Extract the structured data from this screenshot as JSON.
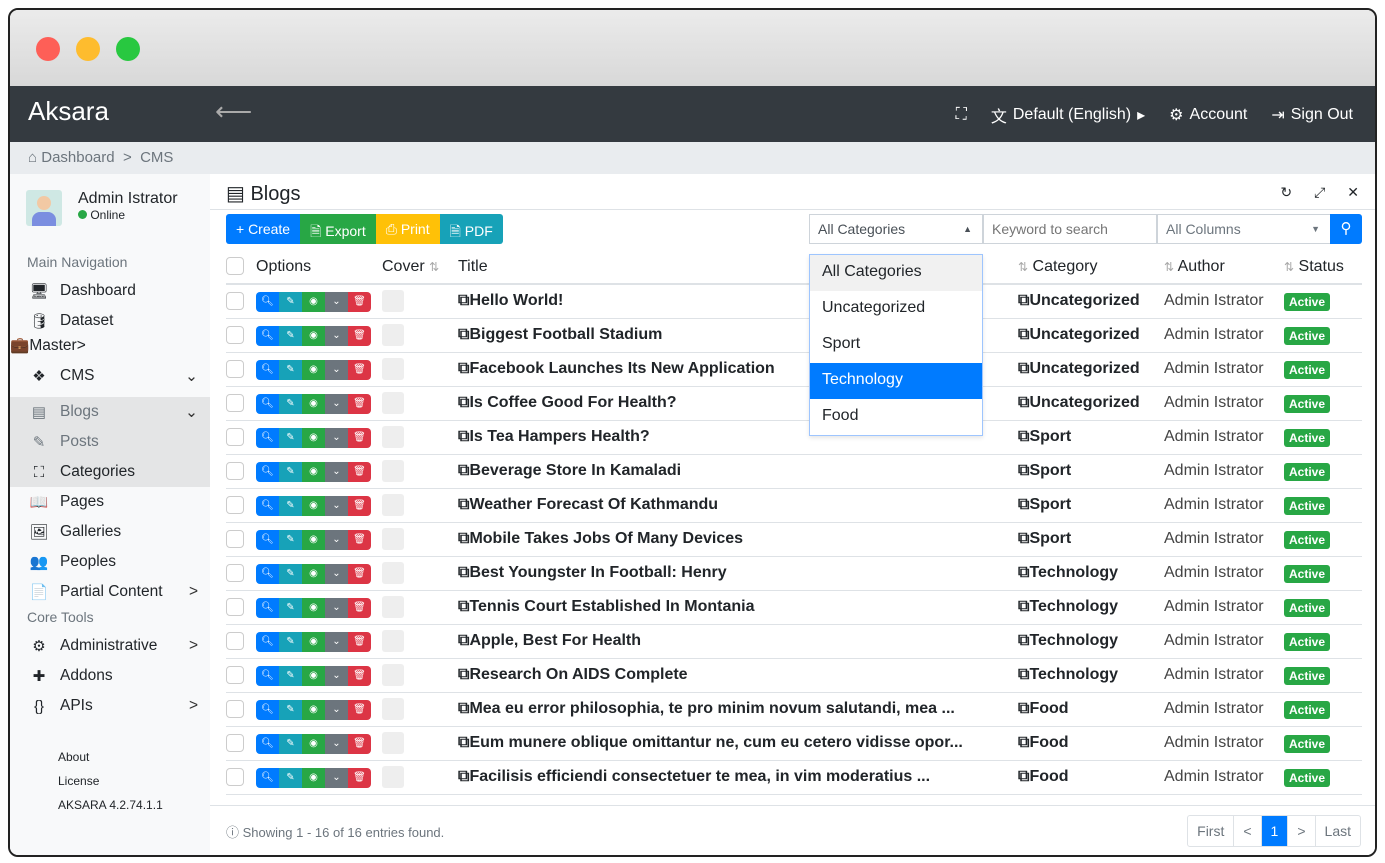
{
  "app": {
    "brand": "Aksara",
    "language": "Default (English)",
    "account": "Account",
    "sign_out": "Sign Out"
  },
  "breadcrumb": [
    "Dashboard",
    ">",
    "CMS"
  ],
  "user": {
    "name": "Admin Istrator",
    "status": "Online"
  },
  "sidebar": {
    "main_header": "Main Navigation",
    "items": [
      {
        "label": "Dashboard",
        "icon": "🖥"
      },
      {
        "label": "Dataset",
        "icon": "🛢"
      },
      {
        "label": "Master",
        "icon": "💼",
        "chevron": ">"
      },
      {
        "label": "CMS",
        "icon": "❖",
        "chevron": "⌄"
      },
      {
        "label": "Blogs",
        "icon": "▤",
        "chevron": "⌄"
      },
      {
        "label": "Posts",
        "icon": "✎"
      },
      {
        "label": "Categories",
        "icon": "⛶"
      },
      {
        "label": "Pages",
        "icon": "📖"
      },
      {
        "label": "Galleries",
        "icon": "🖼"
      },
      {
        "label": "Peoples",
        "icon": "👥"
      },
      {
        "label": "Partial Content",
        "icon": "📄",
        "chevron": ">"
      }
    ],
    "core_header": "Core Tools",
    "core_items": [
      {
        "label": "Administrative",
        "icon": "⚙",
        "chevron": ">"
      },
      {
        "label": "Addons",
        "icon": "✚"
      },
      {
        "label": "APIs",
        "icon": "{}",
        "chevron": ">"
      }
    ],
    "footer": [
      "About",
      "License",
      "AKSARA 4.2.74.1.1"
    ]
  },
  "page": {
    "title": "Blogs"
  },
  "toolbar": {
    "create": "+ Create",
    "export": "Export",
    "print": "Print",
    "pdf": "PDF",
    "category_select": "All Categories",
    "search_placeholder": "Keyword to search",
    "column_select": "All Columns"
  },
  "dropdown": {
    "options": [
      "All Categories",
      "Uncategorized",
      "Sport",
      "Technology",
      "Food"
    ],
    "selected": "Technology"
  },
  "table": {
    "headers": [
      "Options",
      "Cover",
      "Title",
      "Category",
      "Author",
      "Status"
    ],
    "rows": [
      [
        "Hello World!",
        "Uncategorized"
      ],
      [
        "Biggest Football Stadium",
        "Uncategorized"
      ],
      [
        "Facebook Launches Its New Application",
        "Uncategorized"
      ],
      [
        "Is Coffee Good For Health?",
        "Uncategorized"
      ],
      [
        "Is Tea Hampers Health?",
        "Sport"
      ],
      [
        "Beverage Store In Kamaladi",
        "Sport"
      ],
      [
        "Weather Forecast Of Kathmandu",
        "Sport"
      ],
      [
        "Mobile Takes Jobs Of Many Devices",
        "Sport"
      ],
      [
        "Best Youngster In Football: Henry",
        "Technology"
      ],
      [
        "Tennis Court Established In Montania",
        "Technology"
      ],
      [
        "Apple, Best For Health",
        "Technology"
      ],
      [
        "Research On AIDS Complete",
        "Technology"
      ],
      [
        "Mea eu error philosophia, te pro minim novum salutandi, mea ...",
        "Food"
      ],
      [
        "Eum munere oblique omittantur ne, cum eu cetero vidisse opor...",
        "Food"
      ],
      [
        "Facilisis efficiendi consectetuer te mea, in vim moderatius ...",
        "Food"
      ]
    ],
    "author": "Admin Istrator",
    "status": "Active"
  },
  "footer": {
    "info": "Showing 1 - 16 of 16 entries found.",
    "pagination": [
      "First",
      "<",
      "1",
      ">",
      "Last"
    ]
  }
}
